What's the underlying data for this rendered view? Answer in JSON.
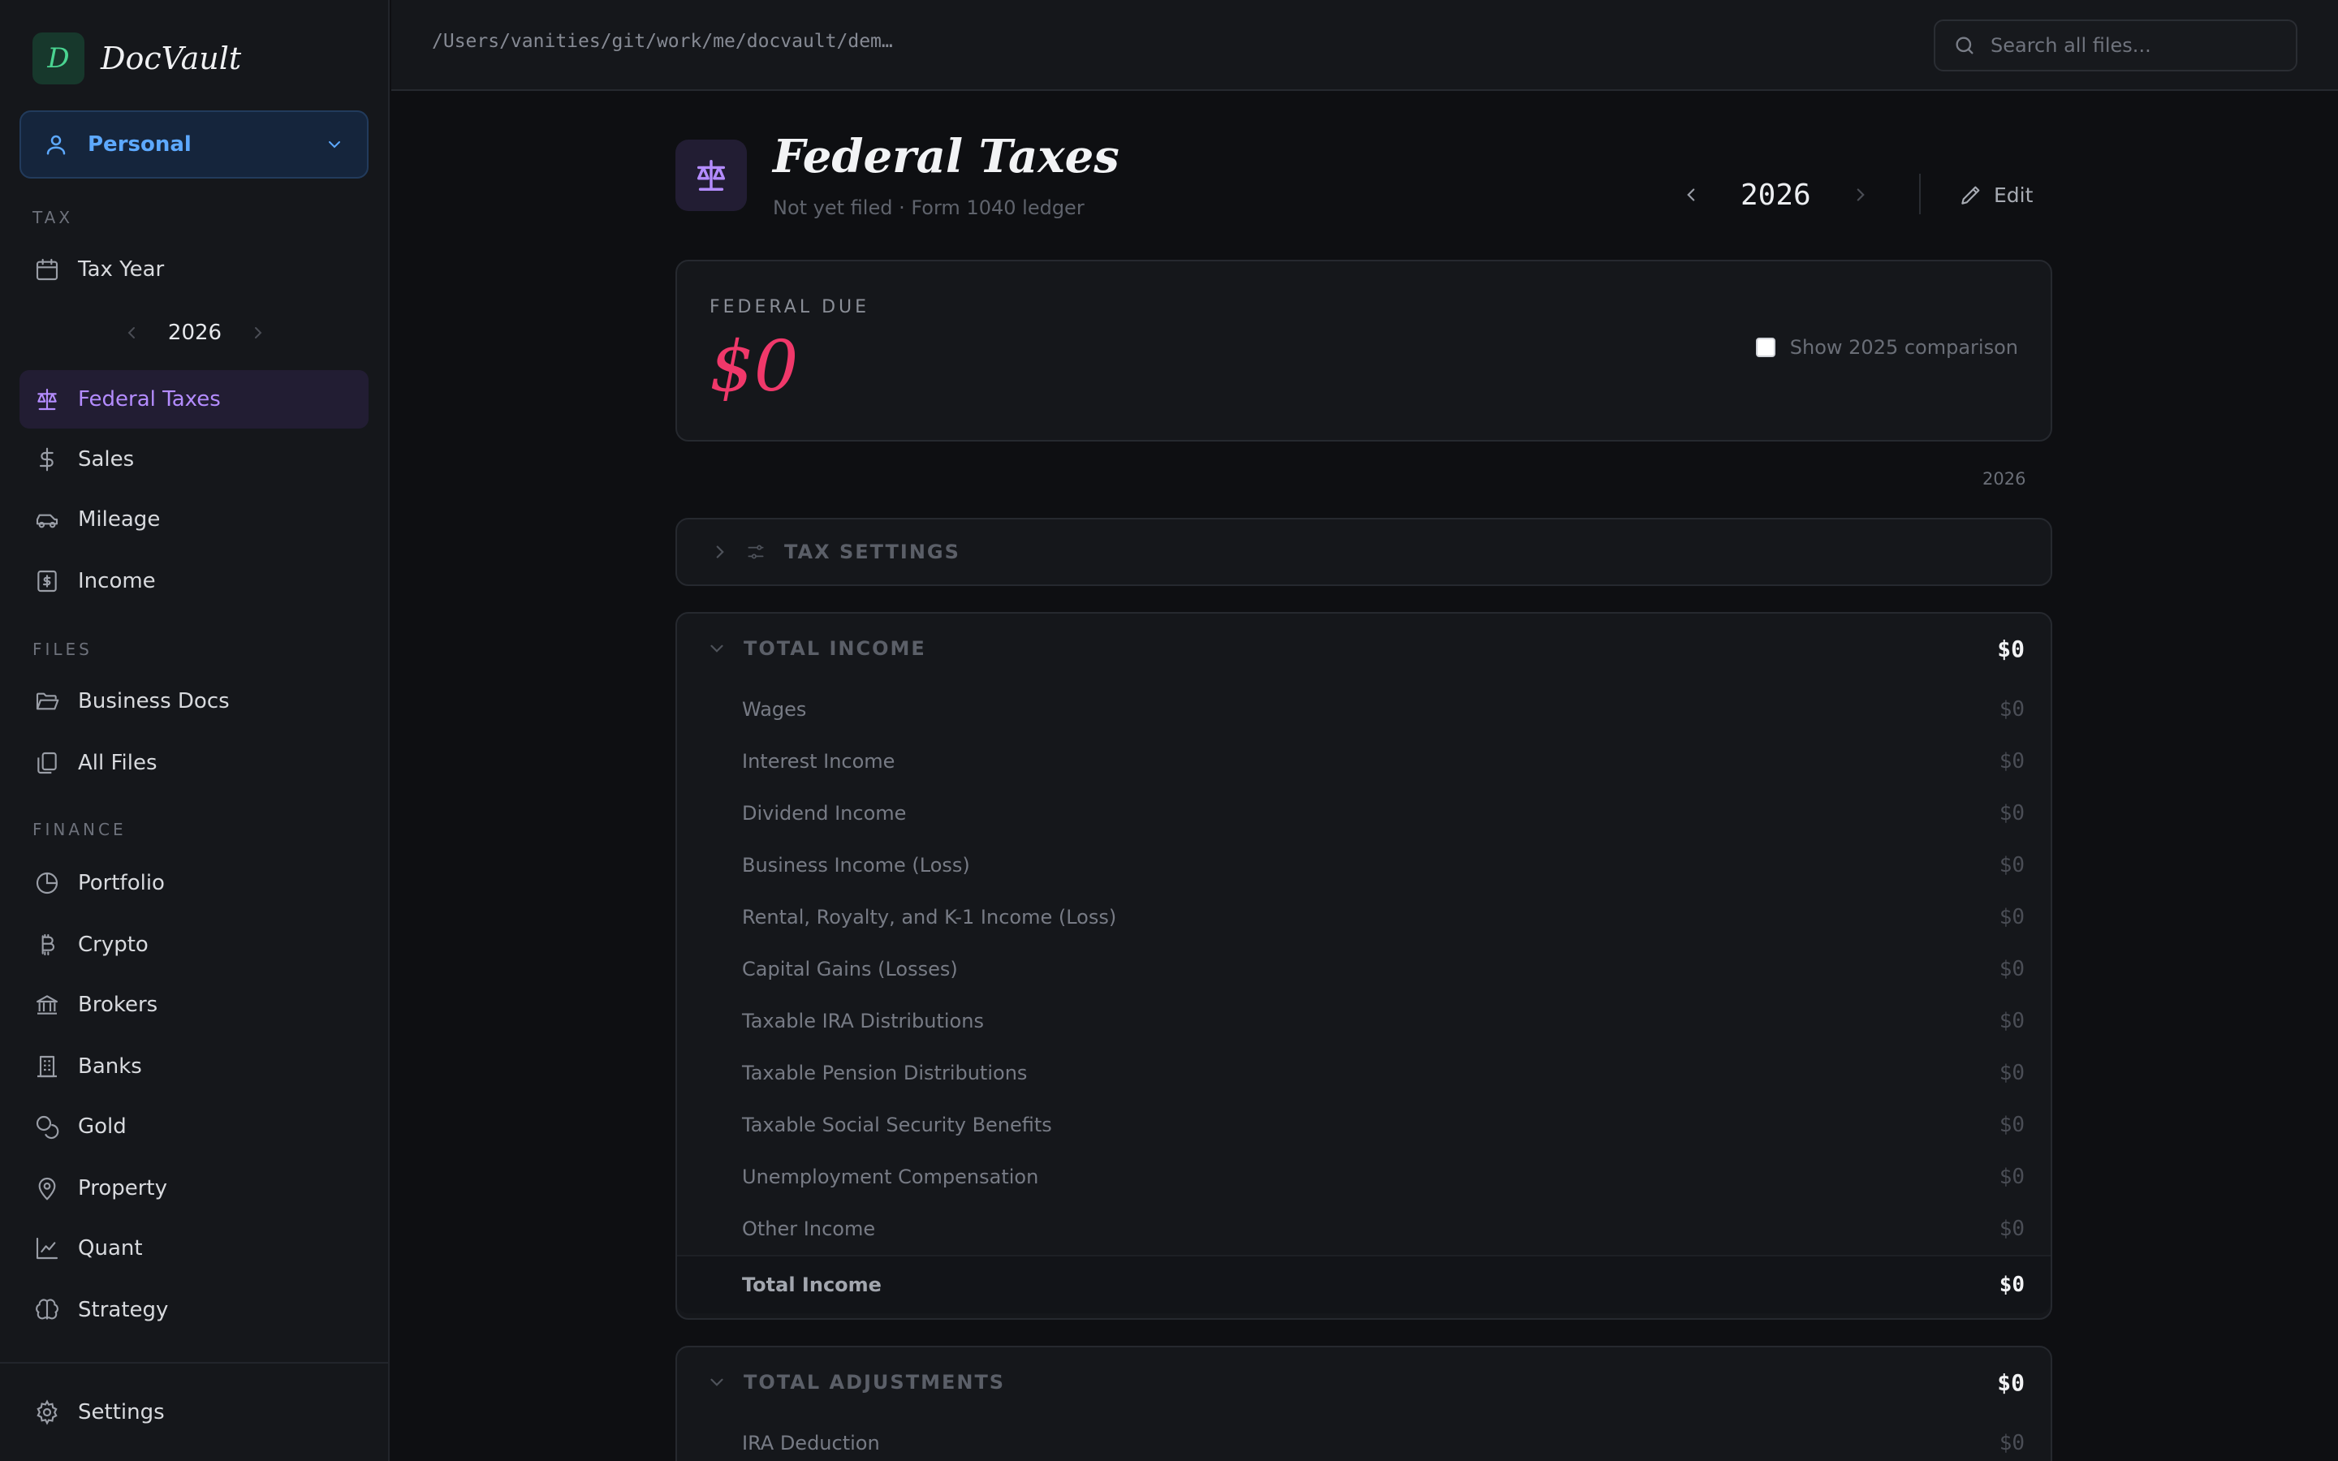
{
  "window": {
    "path": "/Users/vanities/git/work/me/docvault/dem…",
    "search_placeholder": "Search all files..."
  },
  "brand": {
    "logo_letter": "D",
    "name": "DocVault"
  },
  "profile": {
    "label": "Personal"
  },
  "sidebar": {
    "tax_section": "TAX",
    "tax_year_label": "Tax Year",
    "year": "2026",
    "items_tax": [
      {
        "label": "Federal Taxes",
        "icon": "scale-icon",
        "active": true
      },
      {
        "label": "Sales",
        "icon": "dollar-icon"
      },
      {
        "label": "Mileage",
        "icon": "car-icon"
      },
      {
        "label": "Income",
        "icon": "receipt-icon"
      }
    ],
    "files_section": "FILES",
    "items_files": [
      {
        "label": "Business Docs",
        "icon": "folder-open-icon"
      },
      {
        "label": "All Files",
        "icon": "files-icon"
      }
    ],
    "finance_section": "FINANCE",
    "items_finance": [
      {
        "label": "Portfolio",
        "icon": "pie-chart-icon"
      },
      {
        "label": "Crypto",
        "icon": "bitcoin-icon"
      },
      {
        "label": "Brokers",
        "icon": "bank-icon"
      },
      {
        "label": "Banks",
        "icon": "building-icon"
      },
      {
        "label": "Gold",
        "icon": "coins-icon"
      },
      {
        "label": "Property",
        "icon": "map-pin-icon"
      },
      {
        "label": "Quant",
        "icon": "line-chart-icon"
      },
      {
        "label": "Strategy",
        "icon": "brain-icon"
      }
    ],
    "settings_label": "Settings"
  },
  "header": {
    "title": "Federal Taxes",
    "subtitle": "Not yet filed · Form 1040 ledger",
    "year": "2026",
    "edit_label": "Edit"
  },
  "summary": {
    "due_label": "FEDERAL DUE",
    "due_value": "$0",
    "compare_label": "Show 2025 comparison",
    "compare_checked": false,
    "year_caption": "2026"
  },
  "tax_settings": {
    "label": "TAX SETTINGS",
    "expanded": false
  },
  "total_income": {
    "label": "TOTAL INCOME",
    "amount": "$0",
    "lines": [
      {
        "label": "Wages",
        "amount": "$0"
      },
      {
        "label": "Interest Income",
        "amount": "$0"
      },
      {
        "label": "Dividend Income",
        "amount": "$0"
      },
      {
        "label": "Business Income (Loss)",
        "amount": "$0"
      },
      {
        "label": "Rental, Royalty, and K-1 Income (Loss)",
        "amount": "$0"
      },
      {
        "label": "Capital Gains (Losses)",
        "amount": "$0"
      },
      {
        "label": "Taxable IRA Distributions",
        "amount": "$0"
      },
      {
        "label": "Taxable Pension Distributions",
        "amount": "$0"
      },
      {
        "label": "Taxable Social Security Benefits",
        "amount": "$0"
      },
      {
        "label": "Unemployment Compensation",
        "amount": "$0"
      },
      {
        "label": "Other Income",
        "amount": "$0"
      }
    ],
    "total_label": "Total Income",
    "total_amount": "$0"
  },
  "total_adjustments": {
    "label": "TOTAL ADJUSTMENTS",
    "amount": "$0",
    "lines": [
      {
        "label": "IRA Deduction",
        "amount": "$0"
      }
    ]
  },
  "colors": {
    "accent_purple": "#b48cff",
    "accent_blue": "#5da9ff",
    "due_red": "#f0386a",
    "brand_green": "#4ad491"
  }
}
